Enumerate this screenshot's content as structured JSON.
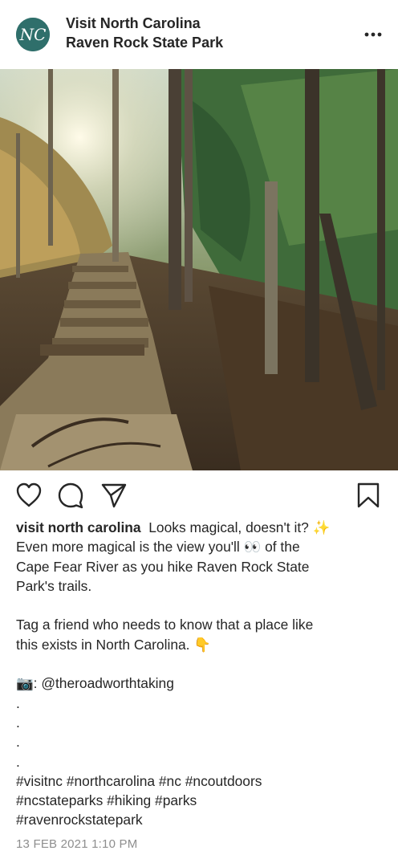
{
  "post": {
    "account_name": "Visit North Carolina",
    "location": "Raven Rock State Park",
    "avatar_text": "NC"
  },
  "caption": {
    "username": "visit north carolina",
    "line1": "Looks magical, doesn't it? ✨",
    "line2": "Even more magical is the view you'll 👀 of the",
    "line3": "Cape Fear River as you hike Raven Rock State",
    "line4": "Park's trails.",
    "line5": "Tag a friend who needs to know that a place like",
    "line6": "this exists in North Carolina. 👇",
    "line7": "📷: @theroadworthtaking",
    "dot": ".",
    "hashtags1": "#visitnc #northcarolina #nc #ncoutdoors",
    "hashtags2": "#ncstateparks #hiking #parks",
    "hashtags3": "#ravenrockstatepark"
  },
  "timestamp": "13 FEB 2021 1:10 PM",
  "icons": {
    "like": "heart-icon",
    "comment": "comment-icon",
    "share": "paper-plane-icon",
    "save": "bookmark-icon",
    "more": "more-options-icon"
  },
  "colors": {
    "avatar_bg": "#2f6f6b",
    "text": "#262626",
    "muted": "#8e8e8e"
  }
}
